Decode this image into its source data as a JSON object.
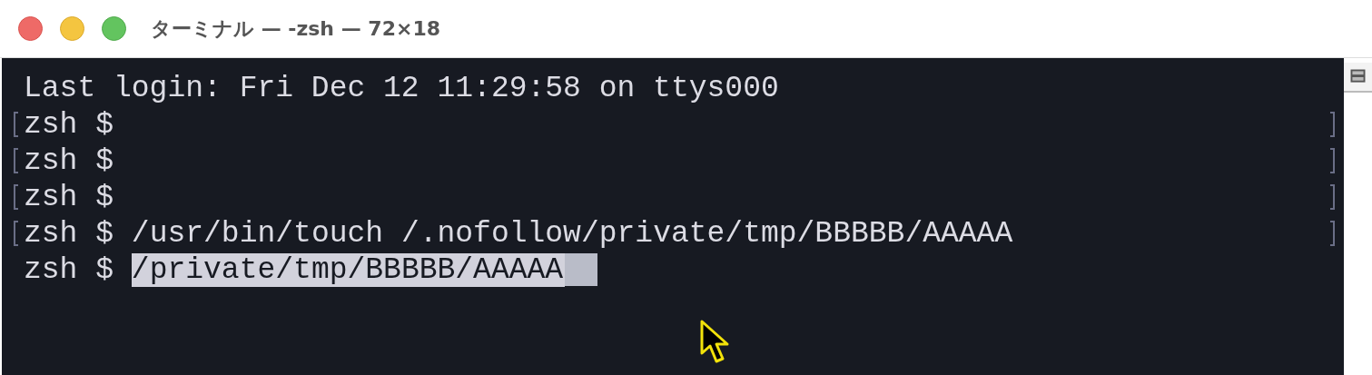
{
  "window": {
    "title": "ターミナル — -zsh — 72×18"
  },
  "lines": [
    {
      "kind": "output",
      "text": "Last login: Fri Dec 12 11:29:58 on ttys000",
      "marked": false
    },
    {
      "kind": "prompt",
      "prompt": "zsh $",
      "marked": true
    },
    {
      "kind": "prompt",
      "prompt": "zsh $",
      "marked": true
    },
    {
      "kind": "prompt",
      "prompt": "zsh $",
      "marked": true
    },
    {
      "kind": "prompt",
      "prompt": "zsh $",
      "command": "/usr/bin/touch /.nofollow/private/tmp/BBBBB/AAAAA",
      "marked": true
    },
    {
      "kind": "prompt",
      "prompt": "zsh $",
      "command": "/private/tmp/BBBBB/AAAAA",
      "marked": false,
      "selected": true,
      "cursor": true
    }
  ]
}
